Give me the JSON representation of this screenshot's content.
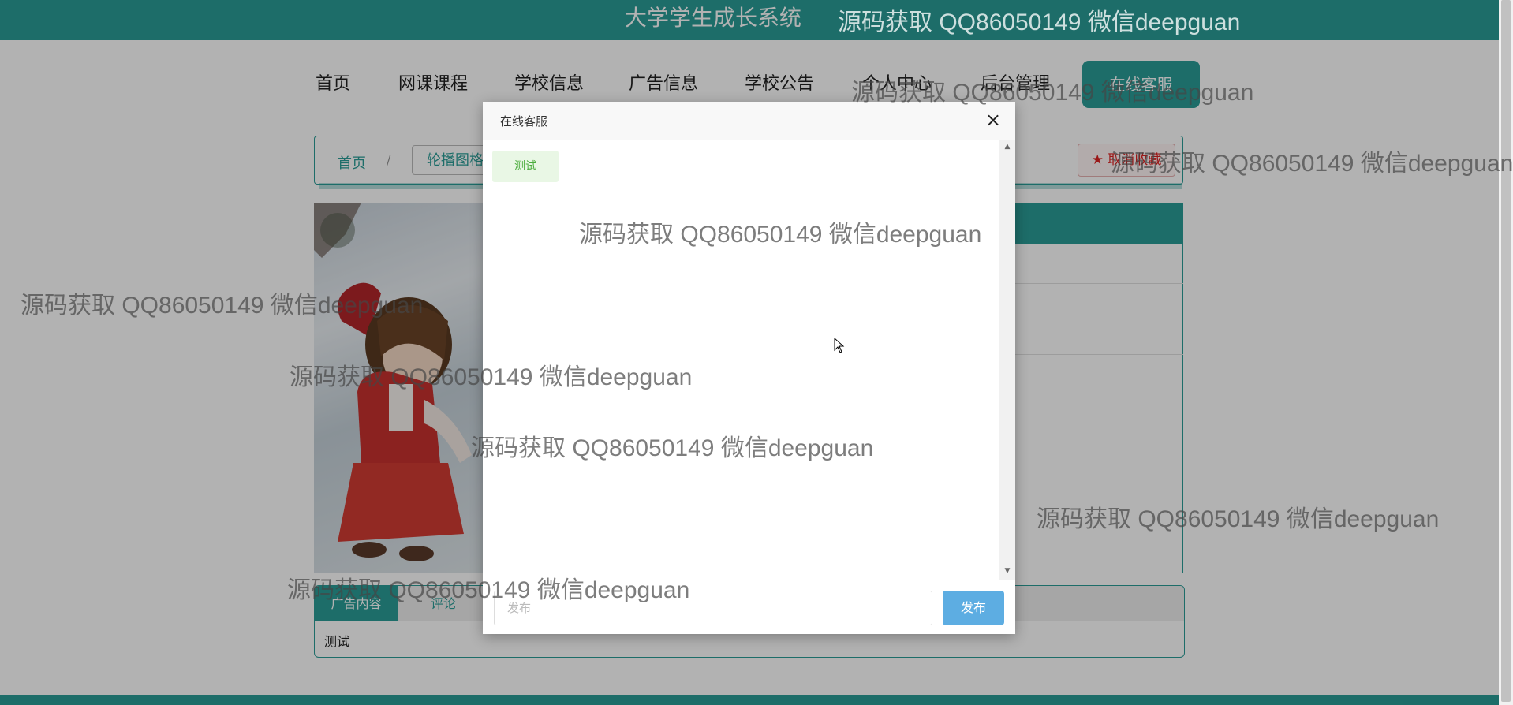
{
  "header": {
    "title": "大学学生成长系统"
  },
  "nav": {
    "items": [
      "首页",
      "网课课程",
      "学校信息",
      "广告信息",
      "学校公告",
      "个人中心",
      "后台管理"
    ],
    "service_button": "在线客服"
  },
  "breadcrumb": {
    "home": "首页",
    "separator": "/",
    "current": "轮播图格"
  },
  "favorite_button": {
    "icon": "★",
    "label": "取消收藏"
  },
  "tabs": {
    "ad_content": "广告内容",
    "comment": "评论",
    "content_text": "测试"
  },
  "modal": {
    "title": "在线客服",
    "close": "×",
    "message": "测试",
    "input_placeholder": "发布",
    "input_value": "",
    "post_button": "发布"
  },
  "watermark": "源码获取 QQ86050149 微信deepguan",
  "colors": {
    "primary": "#2a9d97",
    "post_button": "#5dade2",
    "bubble_text": "#4cad3e",
    "favorite": "#dd2222"
  }
}
